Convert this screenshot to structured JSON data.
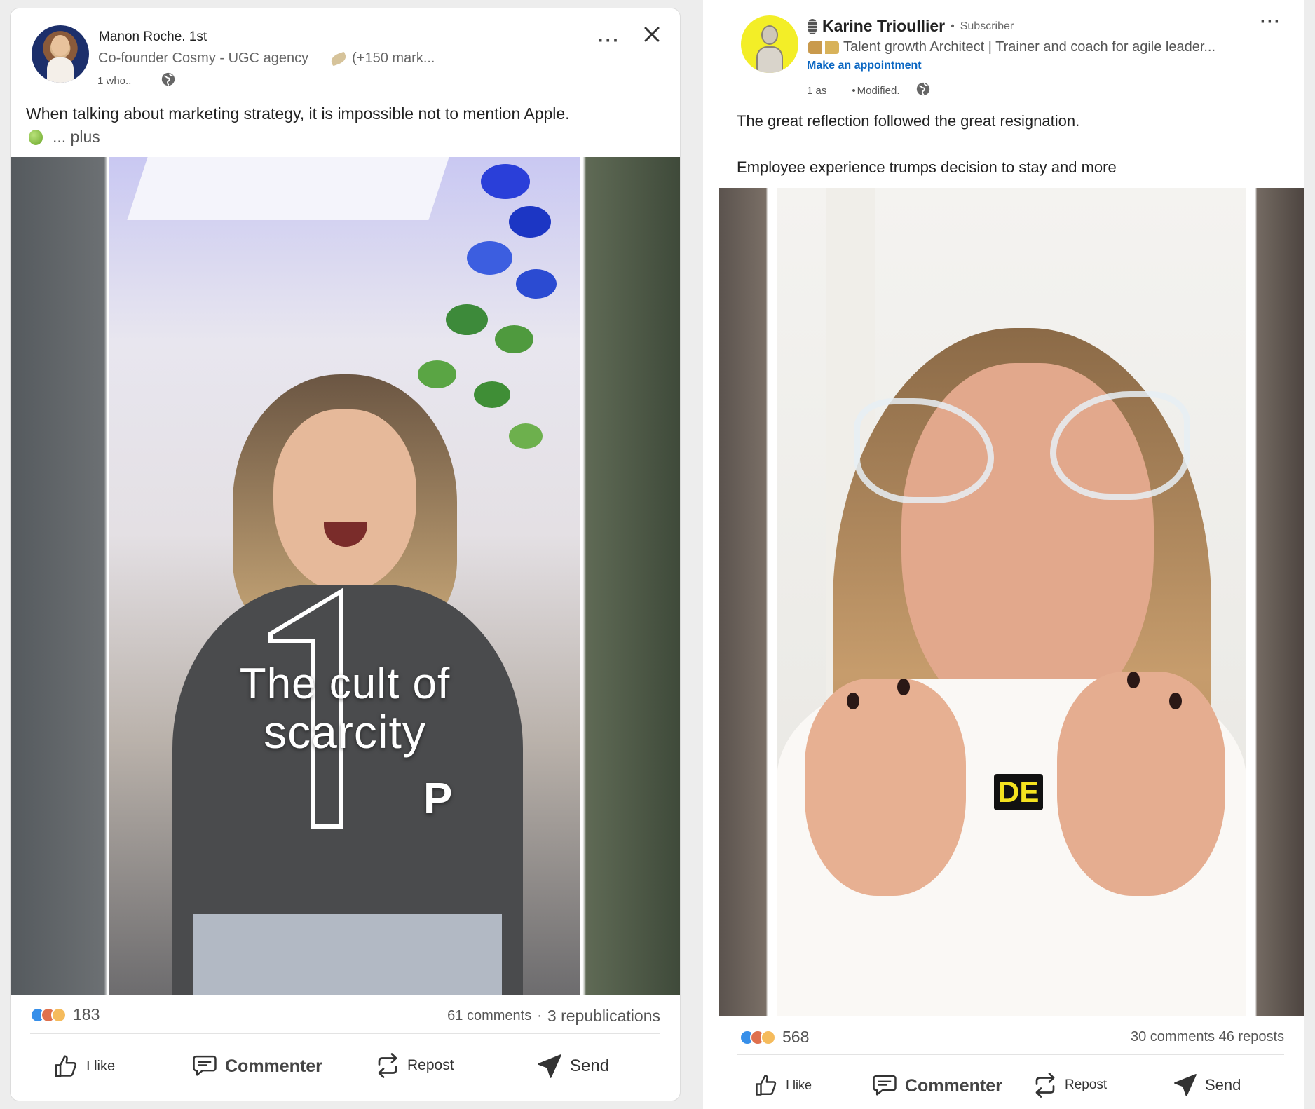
{
  "post1": {
    "author_name": "Manon Roche. 1st",
    "headline": "Co-founder Cosmy - UGC agency",
    "headline_extra": "(+150 mark...",
    "time": "1 who..",
    "text": "When talking about marketing strategy, it is impossible not to mention Apple.",
    "more_label": "... plus",
    "video": {
      "overlay_line1": "The cult of",
      "overlay_line2": "scarcity",
      "overlay_letter": "P"
    },
    "reaction_count": "183",
    "comments": "61 comments",
    "republications": "3 republications",
    "actions": {
      "like": "I like",
      "comment": "Commenter",
      "repost": "Repost",
      "send": "Send"
    },
    "icons": [
      "more-options-icon",
      "close-icon",
      "globe-icon",
      "apple-emoji-icon",
      "feather-emoji-icon"
    ]
  },
  "post2": {
    "author_name": "Karine Trioullier",
    "badge": "Subscriber",
    "headline": "Talent growth Architect | Trainer and coach for agile leader...",
    "cta": "Make an appointment",
    "time": "1 as",
    "modified": "Modified.",
    "text_line1": "The great reflection followed the great resignation.",
    "text_line2": "Employee experience trumps decision to stay and more",
    "video": {
      "subtitle": "DE"
    },
    "reaction_count": "568",
    "comments_reposts": "30 comments 46 reposts",
    "actions": {
      "like": "I like",
      "comment": "Commenter",
      "repost": "Repost",
      "send": "Send"
    },
    "icons": [
      "more-options-icon",
      "globe-icon",
      "microphone-emoji-icon"
    ]
  },
  "colors": {
    "link_blue": "#0a66c2",
    "text_dark": "#222222",
    "text_muted": "#666666",
    "like_blue": "#378fe9",
    "love_red": "#df704d",
    "insight_yellow": "#f5bb5c"
  }
}
